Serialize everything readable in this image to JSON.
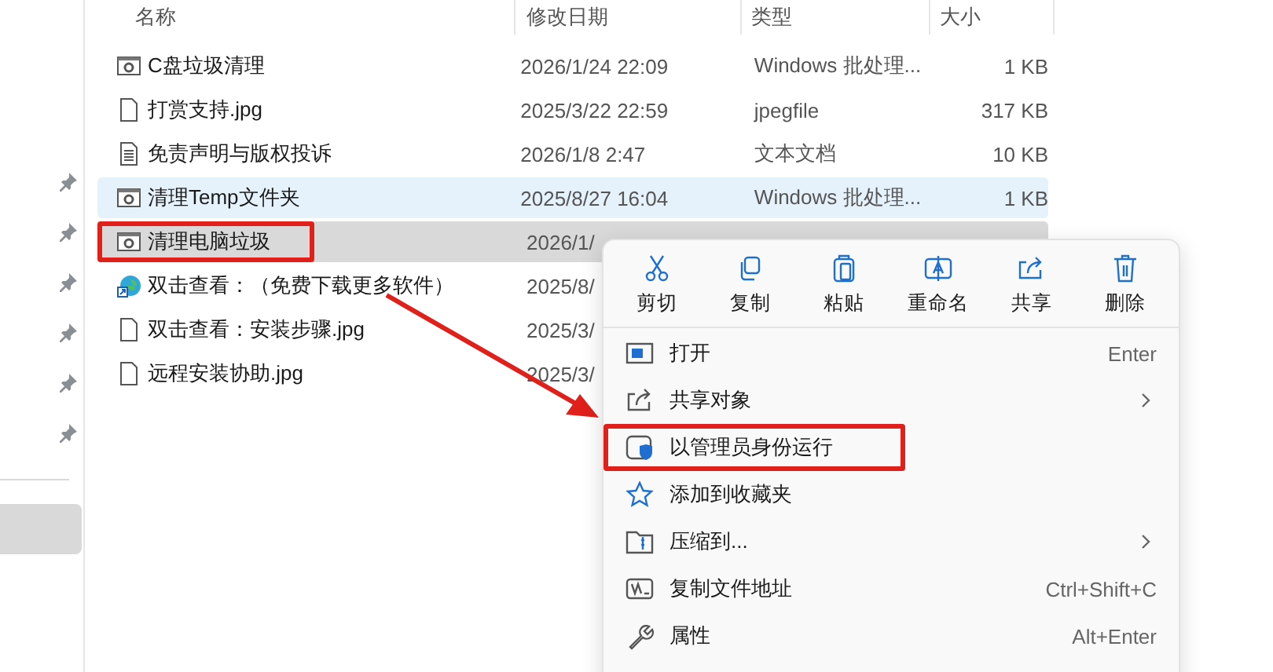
{
  "sidebar": {
    "pinned": [
      {
        "pinned": true
      },
      {
        "pinned": true
      },
      {
        "pinned": true
      },
      {
        "pinned": true
      },
      {
        "pinned": true
      },
      {
        "pinned": true
      }
    ],
    "other": [
      {
        "selected": true
      }
    ]
  },
  "table": {
    "columns": [
      "名称",
      "修改日期",
      "类型",
      "大小"
    ],
    "rows": [
      {
        "kind": "bat",
        "name": "C盘垃圾清理",
        "date": "2026/1/24 22:09",
        "type": "Windows 批处理...",
        "size": "1 KB",
        "hover": false,
        "selected": false,
        "highlighted": false
      },
      {
        "kind": "jpg",
        "name": "打赏支持.jpg",
        "date": "2025/3/22 22:59",
        "type": "jpegfile",
        "size": "317 KB",
        "hover": false,
        "selected": false,
        "highlighted": false
      },
      {
        "kind": "txt",
        "name": "免责声明与版权投诉",
        "date": "2026/1/8 2:47",
        "type": "文本文档",
        "size": "10 KB",
        "hover": false,
        "selected": false,
        "highlighted": false
      },
      {
        "kind": "bat",
        "name": "清理Temp文件夹",
        "date": "2025/8/27 16:04",
        "type": "Windows 批处理...",
        "size": "1 KB",
        "hover": true,
        "selected": false,
        "highlighted": false
      },
      {
        "kind": "bat",
        "name": "清理电脑垃圾",
        "date": "2026/1/",
        "hover": false,
        "selected": true,
        "highlighted": true
      },
      {
        "kind": "shortcut",
        "name": "双击查看：（免费下载更多软件）",
        "date": "2025/8/",
        "hover": false,
        "selected": false,
        "highlighted": false
      },
      {
        "kind": "jpg",
        "name": "双击查看：安装步骤.jpg",
        "date": "2025/3/",
        "hover": false,
        "selected": false,
        "highlighted": false
      },
      {
        "kind": "jpg",
        "name": "远程安装协助.jpg",
        "date": "2025/3/",
        "hover": false,
        "selected": false,
        "highlighted": false
      }
    ]
  },
  "context_menu": {
    "actions": [
      {
        "kind": "cut",
        "label": "剪切"
      },
      {
        "kind": "copy",
        "label": "复制"
      },
      {
        "kind": "paste",
        "label": "粘贴"
      },
      {
        "kind": "rename",
        "label": "重命名"
      },
      {
        "kind": "share",
        "label": "共享"
      },
      {
        "kind": "delete",
        "label": "删除"
      }
    ],
    "items": [
      {
        "kind": "open",
        "label": "打开",
        "shortcut": "Enter",
        "submenu": false,
        "highlighted": false
      },
      {
        "kind": "share",
        "label": "共享对象",
        "submenu": true,
        "highlighted": false
      },
      {
        "kind": "admin",
        "label": "以管理员身份运行",
        "submenu": false,
        "highlighted": true
      },
      {
        "kind": "star",
        "label": "添加到收藏夹",
        "submenu": false,
        "highlighted": false
      },
      {
        "kind": "zip",
        "label": "压缩到...",
        "submenu": true,
        "highlighted": false
      },
      {
        "kind": "path",
        "label": "复制文件地址",
        "shortcut": "Ctrl+Shift+C",
        "submenu": false,
        "highlighted": false
      },
      {
        "kind": "props",
        "label": "属性",
        "shortcut": "Alt+Enter",
        "submenu": false,
        "highlighted": false
      }
    ]
  }
}
